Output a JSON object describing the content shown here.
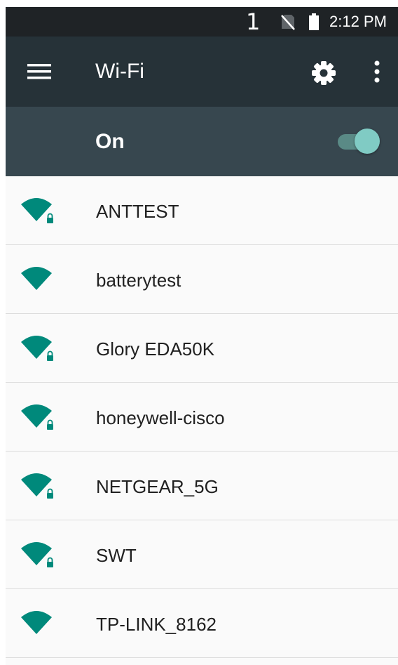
{
  "status_bar": {
    "sim_slot": "1",
    "time": "2:12 PM"
  },
  "toolbar": {
    "title": "Wi-Fi"
  },
  "master_switch": {
    "label": "On",
    "checked": true
  },
  "colors": {
    "accent": "#00897b",
    "toolbar": "#263238",
    "switch_bar": "#37474f",
    "status_bar": "#1f2326"
  },
  "networks": [
    {
      "ssid": "ANTTEST",
      "secured": true,
      "icon": "wifi-signal-full-locked-icon"
    },
    {
      "ssid": "batterytest",
      "secured": false,
      "icon": "wifi-signal-full-icon"
    },
    {
      "ssid": "Glory EDA50K",
      "secured": true,
      "icon": "wifi-signal-full-locked-icon"
    },
    {
      "ssid": "honeywell-cisco",
      "secured": true,
      "icon": "wifi-signal-full-locked-icon"
    },
    {
      "ssid": "NETGEAR_5G",
      "secured": true,
      "icon": "wifi-signal-full-locked-icon"
    },
    {
      "ssid": "SWT",
      "secured": true,
      "icon": "wifi-signal-full-locked-icon"
    },
    {
      "ssid": "TP-LINK_8162",
      "secured": false,
      "icon": "wifi-signal-full-icon"
    }
  ]
}
